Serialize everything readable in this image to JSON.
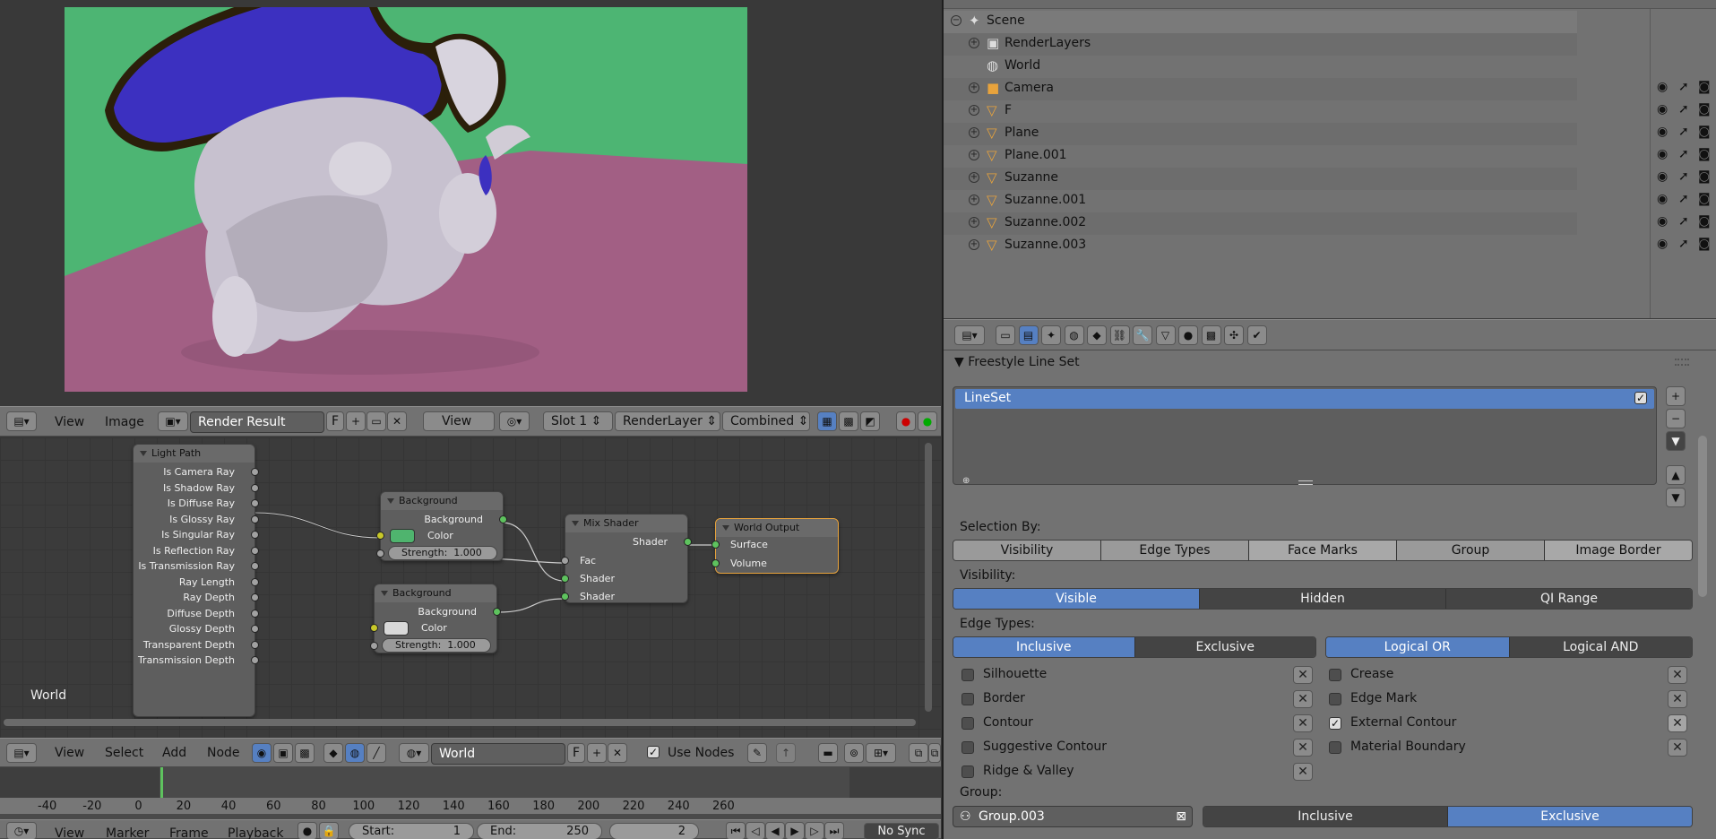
{
  "image_editor": {
    "menu": {
      "view": "View",
      "image": "Image"
    },
    "image_name": "Render Result",
    "fake_user": "F",
    "view_label": "View",
    "slot": "Slot 1",
    "render_layer": "RenderLayer",
    "pass": "Combined"
  },
  "node_editor": {
    "corner_label": "World",
    "menu": {
      "view": "View",
      "select": "Select",
      "add": "Add",
      "node": "Node"
    },
    "world_name": "World",
    "fake_user": "F",
    "use_nodes": "Use Nodes",
    "nodes": {
      "light_path": {
        "title": "Light Path",
        "outputs": [
          "Is Camera Ray",
          "Is Shadow Ray",
          "Is Diffuse Ray",
          "Is Glossy Ray",
          "Is Singular Ray",
          "Is Reflection Ray",
          "Is Transmission Ray",
          "Ray Length",
          "Ray Depth",
          "Diffuse Depth",
          "Glossy Depth",
          "Transparent Depth",
          "Transmission Depth"
        ]
      },
      "background1": {
        "title": "Background",
        "output": "Background",
        "color_label": "Color",
        "strength": "Strength:",
        "strength_value": "1.000",
        "color": "#4fb46e"
      },
      "background2": {
        "title": "Background",
        "output": "Background",
        "color_label": "Color",
        "strength": "Strength:",
        "strength_value": "1.000",
        "color": "#d8d8d8"
      },
      "mix_shader": {
        "title": "Mix Shader",
        "output": "Shader",
        "inputs": [
          "Fac",
          "Shader",
          "Shader"
        ]
      },
      "world_output": {
        "title": "World Output",
        "inputs": [
          "Surface",
          "Volume"
        ]
      }
    }
  },
  "timeline": {
    "ticks": [
      "-40",
      "-20",
      "0",
      "20",
      "40",
      "60",
      "80",
      "100",
      "120",
      "140",
      "160",
      "180",
      "200",
      "220",
      "240",
      "260"
    ],
    "menu": {
      "view": "View",
      "marker": "Marker",
      "frame": "Frame",
      "playback": "Playback"
    },
    "start_label": "Start:",
    "start_value": "1",
    "end_label": "End:",
    "end_value": "250",
    "current_frame": "2",
    "sync": "No Sync"
  },
  "outliner": {
    "items": [
      {
        "name": "Scene"
      },
      {
        "name": "RenderLayers"
      },
      {
        "name": "World"
      },
      {
        "name": "Camera"
      },
      {
        "name": "F"
      },
      {
        "name": "Plane"
      },
      {
        "name": "Plane.001"
      },
      {
        "name": "Suzanne"
      },
      {
        "name": "Suzanne.001"
      },
      {
        "name": "Suzanne.002"
      },
      {
        "name": "Suzanne.003"
      }
    ]
  },
  "properties": {
    "panel_title": "Freestyle Line Set",
    "lineset": "LineSet",
    "selection_by_label": "Selection By:",
    "selection_by": [
      "Visibility",
      "Edge Types",
      "Face Marks",
      "Group",
      "Image Border"
    ],
    "visibility_label": "Visibility:",
    "visibility": [
      "Visible",
      "Hidden",
      "QI Range"
    ],
    "edge_types_label": "Edge Types:",
    "edge_mode": [
      "Inclusive",
      "Exclusive"
    ],
    "logic_mode": [
      "Logical OR",
      "Logical AND"
    ],
    "edge_left": [
      {
        "label": "Silhouette",
        "checked": false
      },
      {
        "label": "Border",
        "checked": false
      },
      {
        "label": "Contour",
        "checked": false
      },
      {
        "label": "Suggestive Contour",
        "checked": false
      },
      {
        "label": "Ridge & Valley",
        "checked": false
      }
    ],
    "edge_right": [
      {
        "label": "Crease",
        "checked": false
      },
      {
        "label": "Edge Mark",
        "checked": false
      },
      {
        "label": "External Contour",
        "checked": true
      },
      {
        "label": "Material Boundary",
        "checked": false
      }
    ],
    "group_label": "Group:",
    "group_name": "Group.003",
    "group_mode": [
      "Inclusive",
      "Exclusive"
    ]
  },
  "colors": {
    "selected": "#5680c2",
    "node_border_active": "#e8a33c",
    "object_icon": "#e8a33c"
  }
}
